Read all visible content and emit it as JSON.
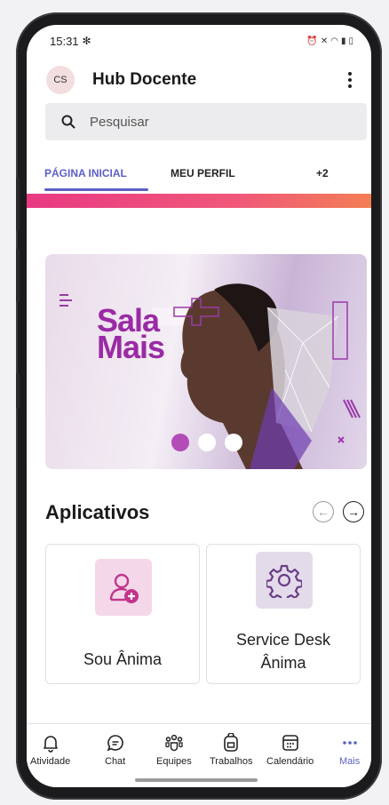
{
  "status_bar": {
    "time": "15:31"
  },
  "header": {
    "avatar_initials": "CS",
    "title": "Hub Docente"
  },
  "search": {
    "placeholder": "Pesquisar"
  },
  "tabs": [
    {
      "label": "PÁGINA INICIAL",
      "active": true
    },
    {
      "label": "MEU PERFIL",
      "active": false
    },
    {
      "label": "+2",
      "active": false
    }
  ],
  "banner": {
    "line1": "Sala",
    "line2": "Mais",
    "slide_count": 3,
    "active_slide": 1
  },
  "apps": {
    "title": "Aplicativos",
    "items": [
      {
        "label": "Sou Ânima",
        "icon": "user-add-icon",
        "bg": "#f5d7ea",
        "color": "#c0358a"
      },
      {
        "label_line1": "Service Desk",
        "label_line2": "Ânima",
        "icon": "gear-icon",
        "bg": "#e3dbea",
        "color": "#6a3d86"
      }
    ]
  },
  "bottom_nav": [
    {
      "label": "Atividade",
      "icon": "bell-icon"
    },
    {
      "label": "Chat",
      "icon": "chat-icon"
    },
    {
      "label": "Equipes",
      "icon": "teams-icon"
    },
    {
      "label": "Trabalhos",
      "icon": "backpack-icon"
    },
    {
      "label": "Calendário",
      "icon": "calendar-icon"
    },
    {
      "label": "Mais",
      "icon": "more-icon",
      "active": true
    }
  ],
  "colors": {
    "accent": "#5b5fc7",
    "banner_text": "#9a2aa5",
    "gradient_start": "#e83a82",
    "gradient_end": "#f27e55"
  }
}
